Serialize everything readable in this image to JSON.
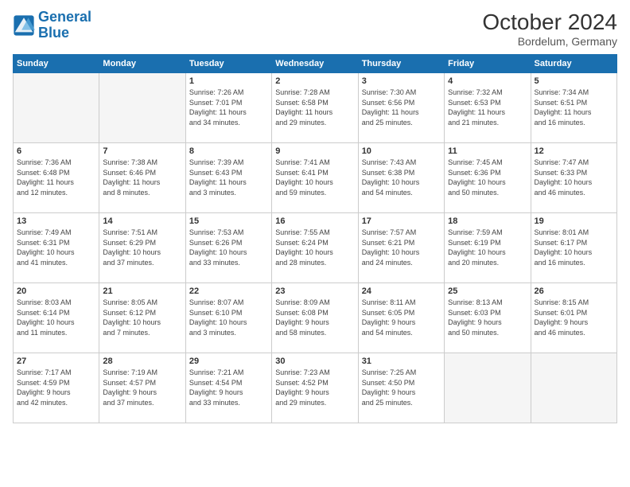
{
  "header": {
    "logo_general": "General",
    "logo_blue": "Blue",
    "month": "October 2024",
    "location": "Bordelum, Germany"
  },
  "days_of_week": [
    "Sunday",
    "Monday",
    "Tuesday",
    "Wednesday",
    "Thursday",
    "Friday",
    "Saturday"
  ],
  "weeks": [
    [
      {
        "day": "",
        "info": ""
      },
      {
        "day": "",
        "info": ""
      },
      {
        "day": "1",
        "info": "Sunrise: 7:26 AM\nSunset: 7:01 PM\nDaylight: 11 hours\nand 34 minutes."
      },
      {
        "day": "2",
        "info": "Sunrise: 7:28 AM\nSunset: 6:58 PM\nDaylight: 11 hours\nand 29 minutes."
      },
      {
        "day": "3",
        "info": "Sunrise: 7:30 AM\nSunset: 6:56 PM\nDaylight: 11 hours\nand 25 minutes."
      },
      {
        "day": "4",
        "info": "Sunrise: 7:32 AM\nSunset: 6:53 PM\nDaylight: 11 hours\nand 21 minutes."
      },
      {
        "day": "5",
        "info": "Sunrise: 7:34 AM\nSunset: 6:51 PM\nDaylight: 11 hours\nand 16 minutes."
      }
    ],
    [
      {
        "day": "6",
        "info": "Sunrise: 7:36 AM\nSunset: 6:48 PM\nDaylight: 11 hours\nand 12 minutes."
      },
      {
        "day": "7",
        "info": "Sunrise: 7:38 AM\nSunset: 6:46 PM\nDaylight: 11 hours\nand 8 minutes."
      },
      {
        "day": "8",
        "info": "Sunrise: 7:39 AM\nSunset: 6:43 PM\nDaylight: 11 hours\nand 3 minutes."
      },
      {
        "day": "9",
        "info": "Sunrise: 7:41 AM\nSunset: 6:41 PM\nDaylight: 10 hours\nand 59 minutes."
      },
      {
        "day": "10",
        "info": "Sunrise: 7:43 AM\nSunset: 6:38 PM\nDaylight: 10 hours\nand 54 minutes."
      },
      {
        "day": "11",
        "info": "Sunrise: 7:45 AM\nSunset: 6:36 PM\nDaylight: 10 hours\nand 50 minutes."
      },
      {
        "day": "12",
        "info": "Sunrise: 7:47 AM\nSunset: 6:33 PM\nDaylight: 10 hours\nand 46 minutes."
      }
    ],
    [
      {
        "day": "13",
        "info": "Sunrise: 7:49 AM\nSunset: 6:31 PM\nDaylight: 10 hours\nand 41 minutes."
      },
      {
        "day": "14",
        "info": "Sunrise: 7:51 AM\nSunset: 6:29 PM\nDaylight: 10 hours\nand 37 minutes."
      },
      {
        "day": "15",
        "info": "Sunrise: 7:53 AM\nSunset: 6:26 PM\nDaylight: 10 hours\nand 33 minutes."
      },
      {
        "day": "16",
        "info": "Sunrise: 7:55 AM\nSunset: 6:24 PM\nDaylight: 10 hours\nand 28 minutes."
      },
      {
        "day": "17",
        "info": "Sunrise: 7:57 AM\nSunset: 6:21 PM\nDaylight: 10 hours\nand 24 minutes."
      },
      {
        "day": "18",
        "info": "Sunrise: 7:59 AM\nSunset: 6:19 PM\nDaylight: 10 hours\nand 20 minutes."
      },
      {
        "day": "19",
        "info": "Sunrise: 8:01 AM\nSunset: 6:17 PM\nDaylight: 10 hours\nand 16 minutes."
      }
    ],
    [
      {
        "day": "20",
        "info": "Sunrise: 8:03 AM\nSunset: 6:14 PM\nDaylight: 10 hours\nand 11 minutes."
      },
      {
        "day": "21",
        "info": "Sunrise: 8:05 AM\nSunset: 6:12 PM\nDaylight: 10 hours\nand 7 minutes."
      },
      {
        "day": "22",
        "info": "Sunrise: 8:07 AM\nSunset: 6:10 PM\nDaylight: 10 hours\nand 3 minutes."
      },
      {
        "day": "23",
        "info": "Sunrise: 8:09 AM\nSunset: 6:08 PM\nDaylight: 9 hours\nand 58 minutes."
      },
      {
        "day": "24",
        "info": "Sunrise: 8:11 AM\nSunset: 6:05 PM\nDaylight: 9 hours\nand 54 minutes."
      },
      {
        "day": "25",
        "info": "Sunrise: 8:13 AM\nSunset: 6:03 PM\nDaylight: 9 hours\nand 50 minutes."
      },
      {
        "day": "26",
        "info": "Sunrise: 8:15 AM\nSunset: 6:01 PM\nDaylight: 9 hours\nand 46 minutes."
      }
    ],
    [
      {
        "day": "27",
        "info": "Sunrise: 7:17 AM\nSunset: 4:59 PM\nDaylight: 9 hours\nand 42 minutes."
      },
      {
        "day": "28",
        "info": "Sunrise: 7:19 AM\nSunset: 4:57 PM\nDaylight: 9 hours\nand 37 minutes."
      },
      {
        "day": "29",
        "info": "Sunrise: 7:21 AM\nSunset: 4:54 PM\nDaylight: 9 hours\nand 33 minutes."
      },
      {
        "day": "30",
        "info": "Sunrise: 7:23 AM\nSunset: 4:52 PM\nDaylight: 9 hours\nand 29 minutes."
      },
      {
        "day": "31",
        "info": "Sunrise: 7:25 AM\nSunset: 4:50 PM\nDaylight: 9 hours\nand 25 minutes."
      },
      {
        "day": "",
        "info": ""
      },
      {
        "day": "",
        "info": ""
      }
    ]
  ]
}
